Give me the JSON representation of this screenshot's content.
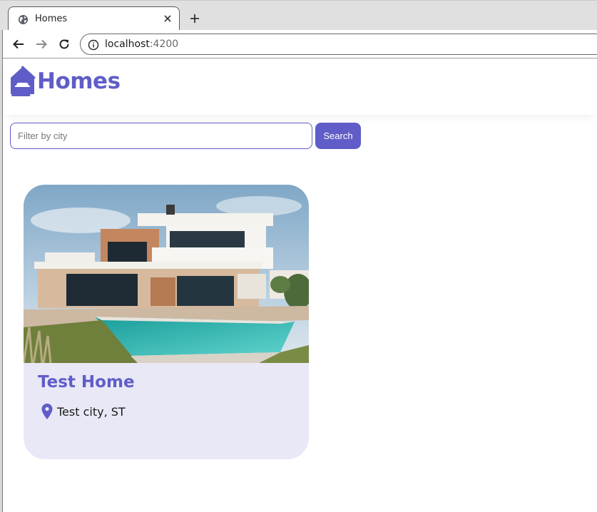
{
  "browser": {
    "tab": {
      "title": "Homes",
      "favicon": "globe-icon"
    },
    "new_tab_icon": "plus-icon",
    "url": {
      "host": "localhost",
      "port": ":4200"
    }
  },
  "header": {
    "logo_icon": "house-icon",
    "brand": "Homes"
  },
  "search": {
    "placeholder": "Filter by city",
    "value": "",
    "button_label": "Search"
  },
  "listings": [
    {
      "title": "Test Home",
      "location": "Test city, ST",
      "location_icon": "map-pin-icon"
    }
  ],
  "colors": {
    "accent": "#605DC8",
    "card_background": "#E8E8F7"
  }
}
